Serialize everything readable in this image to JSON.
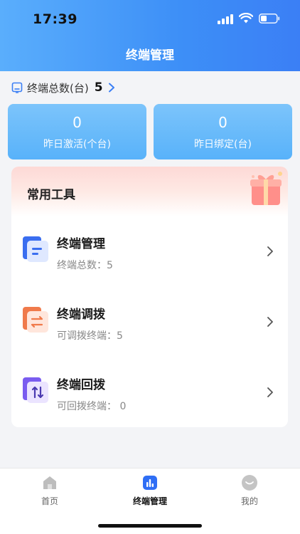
{
  "status": {
    "time": "17:39"
  },
  "nav": {
    "title": "终端管理"
  },
  "total": {
    "label": "终端总数(台)",
    "value": "5"
  },
  "stats": [
    {
      "value": "0",
      "label": "昨日激活(个台)"
    },
    {
      "value": "0",
      "label": "昨日绑定(台)"
    }
  ],
  "tools": {
    "title": "常用工具",
    "items": [
      {
        "name": "终端管理",
        "sub": "终端总数：5",
        "icon": "list-icon",
        "color": "#3a6ef0"
      },
      {
        "name": "终端调拨",
        "sub": "可调拨终端：5",
        "icon": "transfer-icon",
        "color": "#f07a4b"
      },
      {
        "name": "终端回拨",
        "sub": "可回拨终端：  0",
        "icon": "recall-icon",
        "color": "#7a5cf0"
      }
    ]
  },
  "tabbar": {
    "items": [
      {
        "label": "首页",
        "icon": "home-icon"
      },
      {
        "label": "终端管理",
        "icon": "chart-icon"
      },
      {
        "label": "我的",
        "icon": "profile-icon"
      }
    ],
    "active": 1
  },
  "colors": {
    "primary": "#3d8ff7",
    "card": "#58b2fa"
  }
}
